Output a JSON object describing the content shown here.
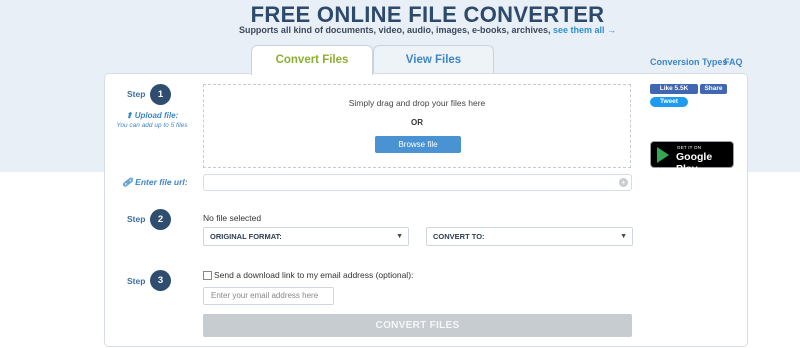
{
  "header": {
    "title": "FREE ONLINE FILE CONVERTER",
    "subtitle": "Supports all kind of documents, video, audio, images, e-books, archives,",
    "subtitle_link": "see them all →"
  },
  "tabs": [
    {
      "label": "Convert Files",
      "active": true
    },
    {
      "label": "View Files",
      "active": false
    }
  ],
  "top_links": {
    "conversion_types": "Conversion Types",
    "faq": "FAQ"
  },
  "step1": {
    "label": "Step",
    "number": "1",
    "upload_label": "Upload file:",
    "upload_hint": "You can add up to 5 files",
    "drop_text": "Simply drag and drop your files here",
    "or_text": "OR",
    "browse_label": "Browse file"
  },
  "url": {
    "label": "Enter file url:",
    "value": ""
  },
  "step2": {
    "label": "Step",
    "number": "2",
    "status": "No file selected",
    "original_format": "ORIGINAL FORMAT:",
    "convert_to": "CONVERT TO:"
  },
  "step3": {
    "label": "Step",
    "number": "3",
    "email_checkbox_label": "Send a download link to my email address (optional):",
    "email_placeholder": "Enter your email address here",
    "convert_button": "CONVERT FILES"
  },
  "social": {
    "fb_like": "Like 5.5K",
    "fb_share": "Share",
    "tweet": "Tweet"
  },
  "store_badge": {
    "small": "GET IT ON",
    "big": "Google Play"
  },
  "colors": {
    "header_bg": "#e9eff6",
    "title": "#2e4a6b",
    "accent_green": "#8cae32",
    "accent_blue": "#3d86c6",
    "step_circle": "#2f4d6e",
    "browse_button": "#4a93d2",
    "convert_button_disabled": "#c7ccd1"
  }
}
